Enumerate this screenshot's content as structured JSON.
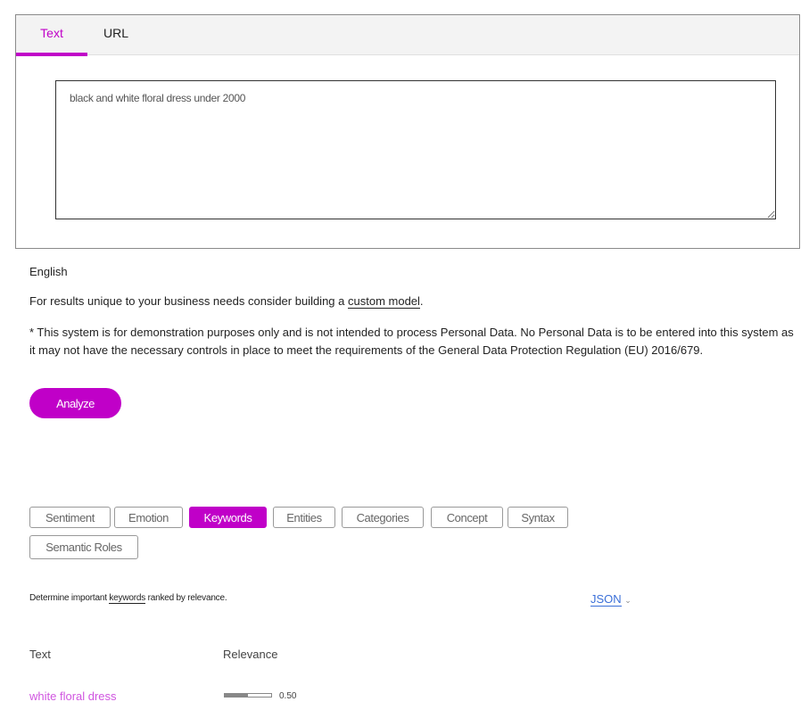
{
  "input_tabs": [
    {
      "label": "Text",
      "active": true
    },
    {
      "label": "URL",
      "active": false
    }
  ],
  "input_text": "black and white floral dress under 2000",
  "language": "English",
  "custom_model": {
    "prefix": "For results unique to your business needs consider building a ",
    "link": "custom model",
    "suffix": "."
  },
  "disclaimer": "* This system is for demonstration purposes only and is not intended to process Personal Data. No Personal Data is to be entered into this system as it may not have the necessary controls in place to meet the requirements of the General Data Protection Regulation (EU) 2016/679.",
  "analyze_label": "Analyze",
  "feature_tabs": [
    "Sentiment",
    "Emotion",
    "Keywords",
    "Entities",
    "Categories",
    "Concept",
    "Syntax",
    "Semantic Roles"
  ],
  "active_feature": "Keywords",
  "description": {
    "prefix": "Determine important ",
    "link": "keywords",
    "suffix": " ranked by relevance."
  },
  "json_label": "JSON",
  "table": {
    "headers": [
      "Text",
      "Relevance"
    ],
    "rows": [
      {
        "text": "white floral dress",
        "relevance": 0.5,
        "relevance_label": "0.50"
      }
    ]
  },
  "colors": {
    "accent": "#c000c8",
    "keyword": "#d055e0",
    "link": "#3a6fd8"
  }
}
